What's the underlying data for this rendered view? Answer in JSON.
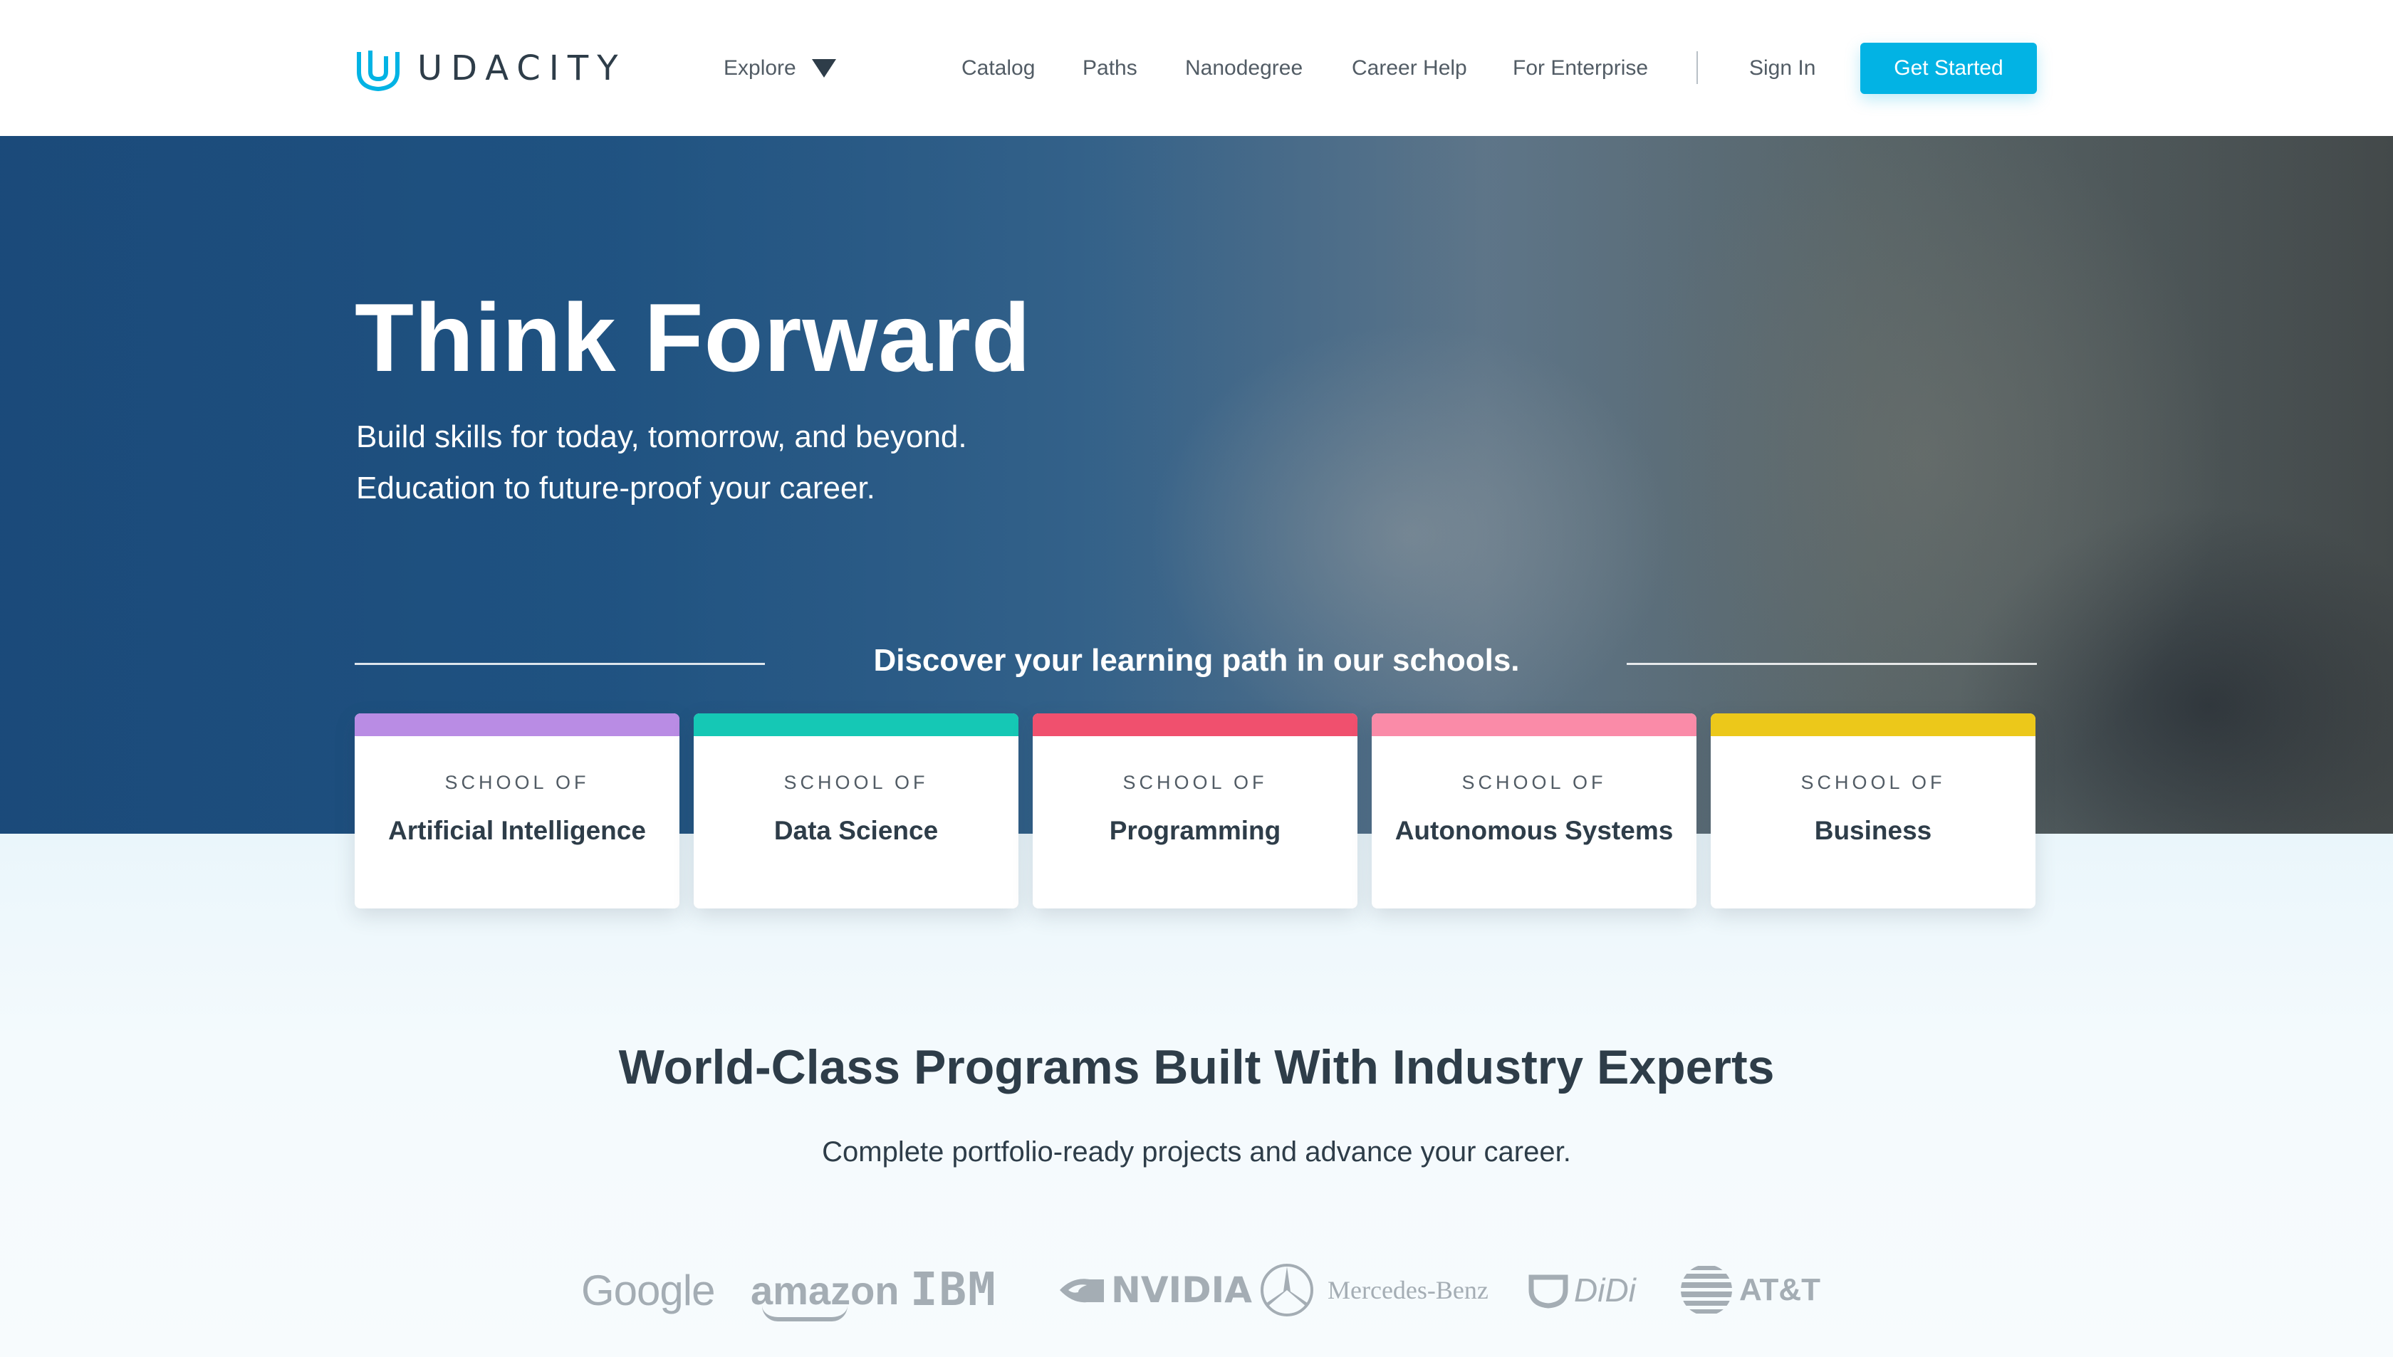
{
  "header": {
    "brand": "UDACITY",
    "explore_label": "Explore",
    "nav": [
      "Catalog",
      "Paths",
      "Nanodegree",
      "Career Help",
      "For Enterprise"
    ],
    "sign_in": "Sign In",
    "cta": "Get Started"
  },
  "hero": {
    "title": "Think Forward",
    "subtitle_line1": "Build skills for today, tomorrow, and beyond.",
    "subtitle_line2": "Education to future-proof your career.",
    "discover": "Discover your learning path in our schools."
  },
  "schools": [
    {
      "kicker": "SCHOOL OF",
      "name": "Artificial Intelligence",
      "color": "#b98ce4"
    },
    {
      "kicker": "SCHOOL OF",
      "name": "Data Science",
      "color": "#15c8b5"
    },
    {
      "kicker": "SCHOOL OF",
      "name": "Programming",
      "color": "#f0506e"
    },
    {
      "kicker": "SCHOOL OF",
      "name": "Autonomous Systems",
      "color": "#fa8ba8"
    },
    {
      "kicker": "SCHOOL OF",
      "name": "Business",
      "color": "#ecc81a"
    }
  ],
  "programs": {
    "title": "World-Class Programs Built With Industry Experts",
    "subtitle": "Complete portfolio-ready projects and advance your career."
  },
  "partners": [
    "Google",
    "amazon",
    "IBM",
    "NVIDIA",
    "Mercedes-Benz",
    "DiDi",
    "AT&T"
  ],
  "colors": {
    "accent": "#02b3e4",
    "text_dark": "#2e3d49",
    "logo_gray": "#a4adb4"
  }
}
